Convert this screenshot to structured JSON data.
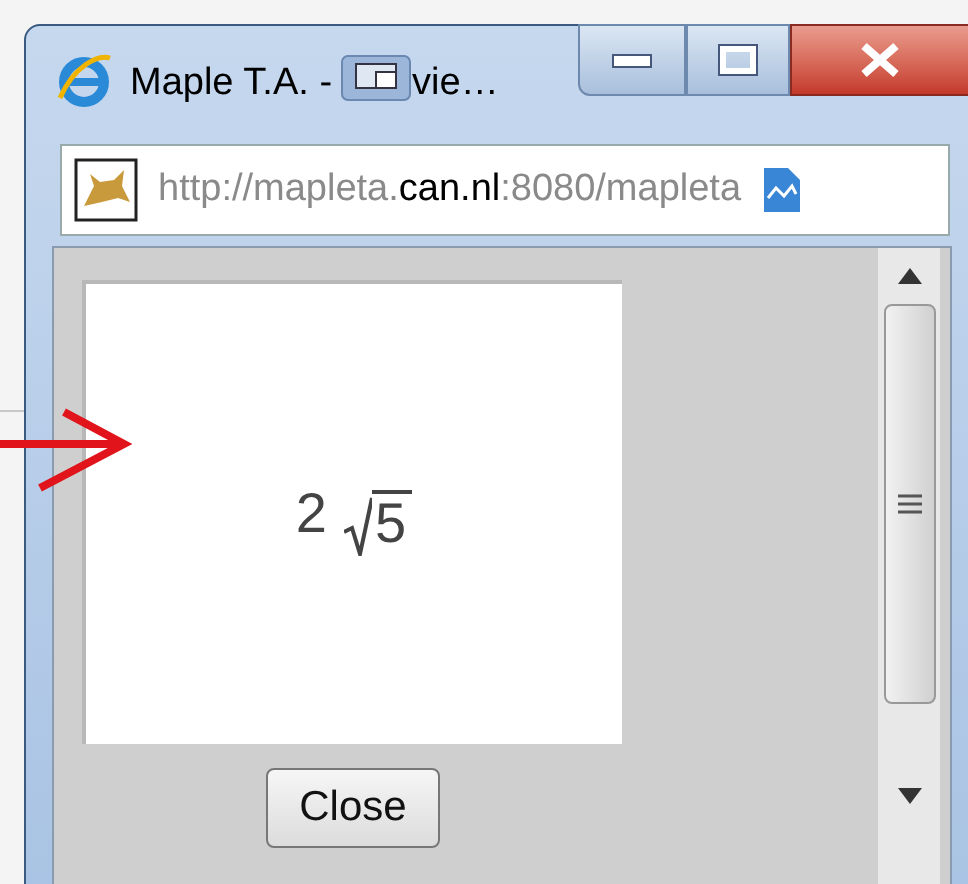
{
  "window": {
    "title_start": "Maple T.A. -",
    "title_end": "vie…"
  },
  "address_bar": {
    "url_parts": [
      {
        "text": "http://mapleta.",
        "emphasis": false
      },
      {
        "text": "can.nl",
        "emphasis": true
      },
      {
        "text": ":8080/mapleta",
        "emphasis": false
      }
    ]
  },
  "preview": {
    "number": "2",
    "radicand": "5"
  },
  "buttons": [
    {
      "label": "Close"
    }
  ]
}
